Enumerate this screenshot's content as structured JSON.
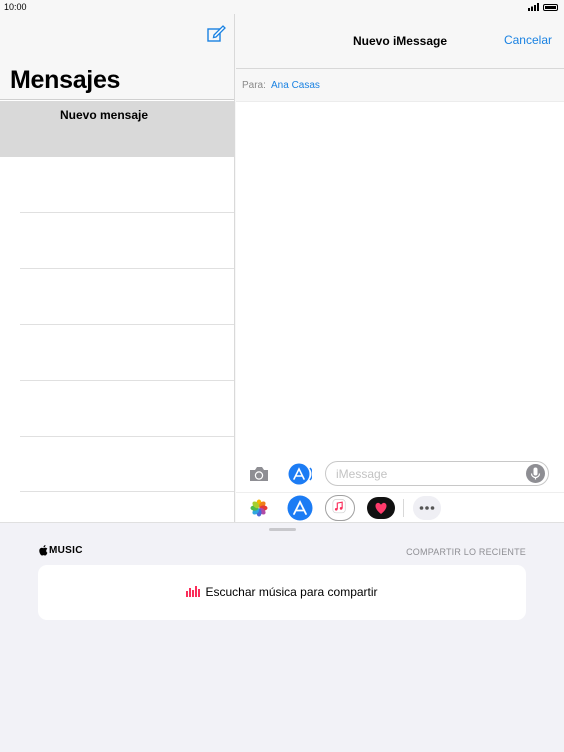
{
  "status": {
    "time": "10:00"
  },
  "left_pane": {
    "title": "Mensajes",
    "new_message_label": "Nuevo mensaje"
  },
  "right_pane": {
    "title": "Nuevo iMessage",
    "cancel_label": "Cancelar",
    "to_label": "Para:",
    "to_recipient": "Ana Casas",
    "input_placeholder": "iMessage"
  },
  "app_drawer": {
    "icons": [
      "photos-icon",
      "app-store-icon",
      "music-icon",
      "digital-touch-icon",
      "more-icon"
    ],
    "selected": "music-icon"
  },
  "music_panel": {
    "brand": "MUSIC",
    "share_recent_label": "COMPARTIR LO RECIENTE",
    "listen_label": "Escuchar música para compartir"
  },
  "colors": {
    "accent": "#1a82e2",
    "music_pink": "#fa2d5a",
    "app_store_blue": "#1c7cf4"
  }
}
